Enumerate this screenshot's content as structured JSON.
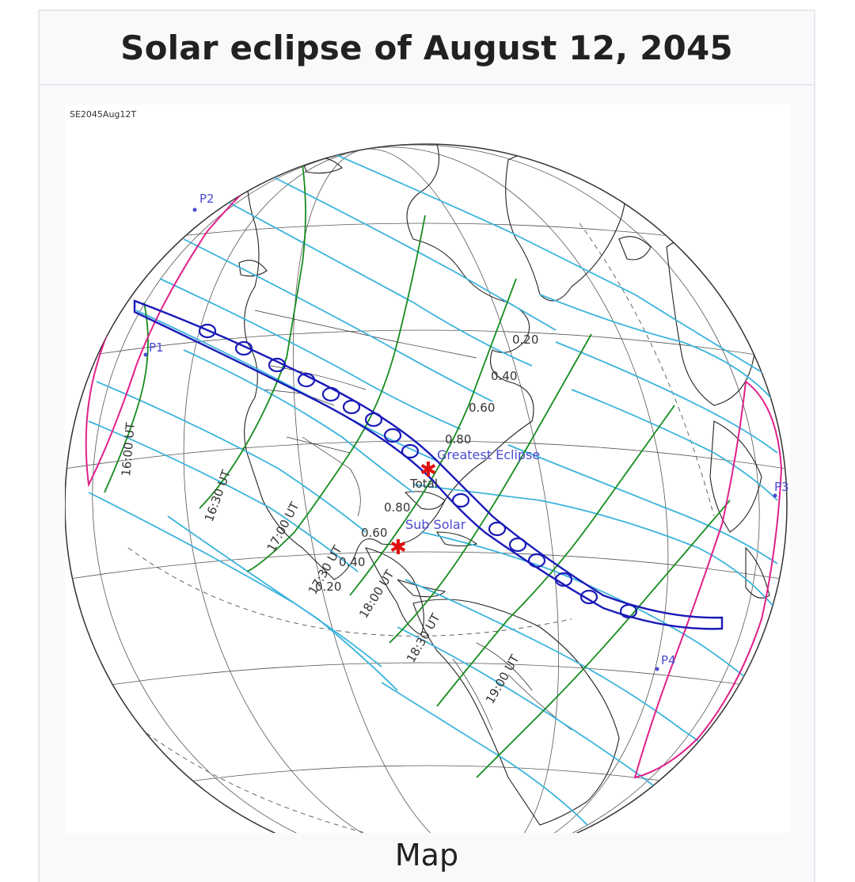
{
  "infobox": {
    "title": "Solar eclipse of August 12, 2045",
    "caption": "Map"
  },
  "map": {
    "map_id": "SE2045Aug12T",
    "contact_points": [
      "P1",
      "P2",
      "P3",
      "P4"
    ],
    "time_labels": [
      "16:00 UT",
      "16:30 UT",
      "17:00 UT",
      "17:30 UT",
      "18:00 UT",
      "18:30 UT",
      "19:00 UT"
    ],
    "magnitude_labels_north": [
      "0.20",
      "0.40",
      "0.60",
      "0.80"
    ],
    "magnitude_labels_south": [
      "0.80",
      "0.60",
      "0.40",
      "0.20"
    ],
    "greatest_eclipse_label": "Greatest Eclipse",
    "total_label": "Total",
    "sub_solar_label": "Sub Solar",
    "colors": {
      "totality_path": "#1a1ab8",
      "magnitude_lines": "#3bb4dc",
      "time_lines": "#168c1e",
      "limit_curves": "#e0208c",
      "marker": "#e01010",
      "label_blue": "#4a4ad0",
      "coastline": "#222222"
    }
  }
}
